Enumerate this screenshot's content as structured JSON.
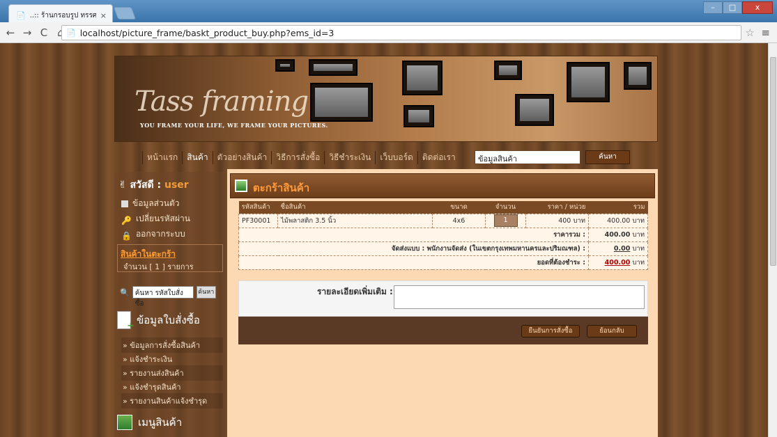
{
  "browser": {
    "tab_title": "..:: ร้านกรอบรูป ทรรศ เฟรมมิ่ง ::..",
    "tab_close": "×",
    "url": "localhost/picture_frame/baskt_product_buy.php?ems_id=3",
    "win_min": "–",
    "win_max": "□",
    "win_close": "x"
  },
  "banner": {
    "logo": "Tass framing",
    "slogan": "YOU FRAME YOUR LIFE, WE FRAME YOUR PICTURES."
  },
  "topnav": {
    "items": [
      "หน้าแรก",
      "สินค้า",
      "ตัวอย่างสินค้า",
      "วิธีการสั่งซื้อ",
      "วิธีชำระเงิน",
      "เว็บบอร์ด",
      "ติดต่อเรา"
    ],
    "search_value": "ข้อมูลสินค้า",
    "search_button": "ค้นหา"
  },
  "sidebar": {
    "greeting_label": "สวัสดี :",
    "greeting_user": "user",
    "account": [
      "ข้อมูลส่วนตัว",
      "เปลี่ยนรหัสผ่าน",
      "ออกจากระบบ"
    ],
    "cart_title": "สินค้าในตะกร้า",
    "cart_count": "จำนวน [ 1 ] รายการ",
    "order_search_value": "ค้นหา รหัสใบสั่งซื้อ",
    "order_search_button": "ค้นหา",
    "orders_title": "ข้อมูลใบสั่งซื้อ",
    "order_links": [
      "ข้อมูลการสั่งซื้อสินค้า",
      "แจ้งชำระเงิน",
      "รายงานส่งสินค้า",
      "แจ้งชำรุดสินค้า",
      "รายงานสินค้าแจ้งชำรุด"
    ],
    "products_title": "เมนูสินค้า"
  },
  "main": {
    "title": "ตะกร้าสินค้า",
    "columns": [
      "รหัสสินค้า",
      "ชื่อสินค้า",
      "ขนาด",
      "จำนวน",
      "ราคา / หน่วย",
      "รวม"
    ],
    "row": {
      "code": "PF30001",
      "name": "ไม้พลาสติก 3.5 นิ้ว",
      "size": "4x6",
      "qty": "1",
      "unit_price": "400 บาท",
      "total": "400.00 บาท"
    },
    "sum_label": "ราคารวม :",
    "sum_value": "400.00",
    "shipping_label": "จัดส่งแบบ : พนักงานจัดส่ง (ในเขตกรุงเทพมหานครและปริมณฑล) :",
    "shipping_value": "0.00",
    "grand_label": "ยอดที่ต้องชำระ :",
    "grand_value": "400.00",
    "currency": "บาท",
    "detail_label": "รายละเอียดเพิ่มเติม :",
    "confirm_button": "ยืนยันการสั่งซื้อ",
    "back_button": "ย้อนกลับ"
  }
}
